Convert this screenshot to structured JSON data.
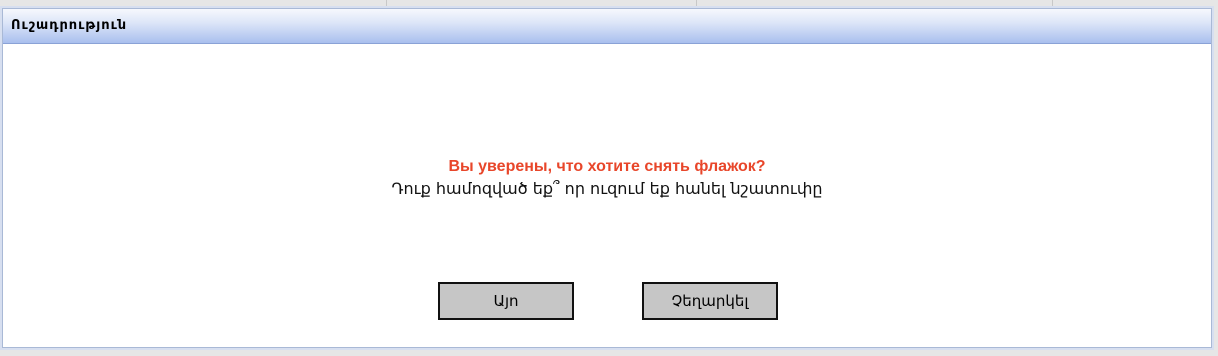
{
  "dialog": {
    "title": "Ուշադրություն",
    "message_ru": "Вы уверены, что хотите снять флажок?",
    "message_hy": "Դուք համոզված եք՞ որ ուզում եք հանել նշատուփը",
    "buttons": {
      "yes_label": "Այո",
      "cancel_label": "Չեղարկել"
    }
  },
  "colors": {
    "title_gradient_top": "#f6f8fd",
    "title_gradient_bottom": "#a9bfee",
    "warning_text": "#e8462a",
    "button_bg": "#c6c6c6"
  }
}
